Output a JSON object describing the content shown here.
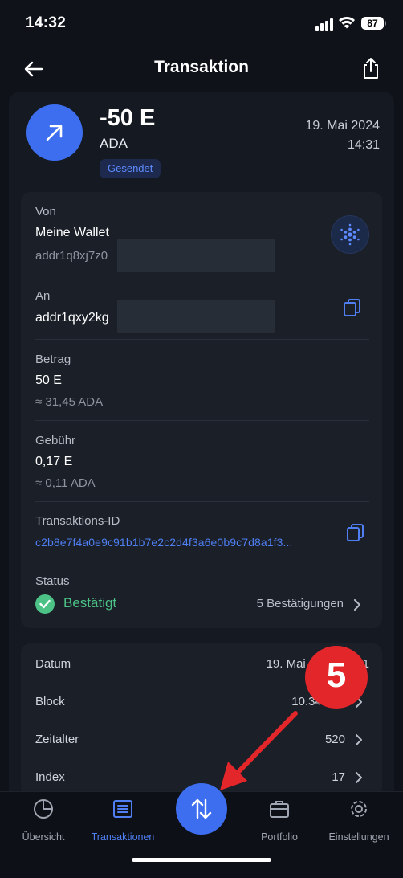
{
  "status_bar": {
    "time": "14:32",
    "battery": "87"
  },
  "header": {
    "title": "Transaktion"
  },
  "hero": {
    "amount": "-50 E",
    "currency": "ADA",
    "badge": "Gesendet",
    "date": "19. Mai 2024",
    "time": "14:31"
  },
  "details": {
    "from_label": "Von",
    "from_name": "Meine Wallet",
    "from_address": "addr1q8xj7z0",
    "to_label": "An",
    "to_address": "addr1qxy2kg",
    "amount_label": "Betrag",
    "amount_value": "50 E",
    "amount_fiat": "≈ 31,45 ADA",
    "fee_label": "Gebühr",
    "fee_value": "0,17 E",
    "fee_fiat": "≈ 0,11 ADA",
    "txid_label": "Transaktions-ID",
    "txid_value": "c2b8e7f4a0e9c91b1b7e2c2d4f3a6e0b9c7d8a1f3...",
    "status_label": "Status",
    "status_value": "Bestätigt",
    "confirmations": "5 Bestätigungen"
  },
  "meta": {
    "rows": [
      {
        "label": "Datum",
        "value": "19. Mai 2024 14:31"
      },
      {
        "label": "Block",
        "value": "10.345.67"
      },
      {
        "label": "Zeitalter",
        "value": "520"
      },
      {
        "label": "Index",
        "value": "17"
      }
    ]
  },
  "tabs": [
    {
      "label": "Übersicht"
    },
    {
      "label": "Transaktionen"
    },
    {
      "label": "Portfolio"
    },
    {
      "label": "Einstellungen"
    }
  ],
  "annotation": {
    "number": "5"
  },
  "colors": {
    "accent": "#3d6ef0",
    "link": "#4f7ff3",
    "success": "#4cc286",
    "annotation": "#e3262a"
  }
}
